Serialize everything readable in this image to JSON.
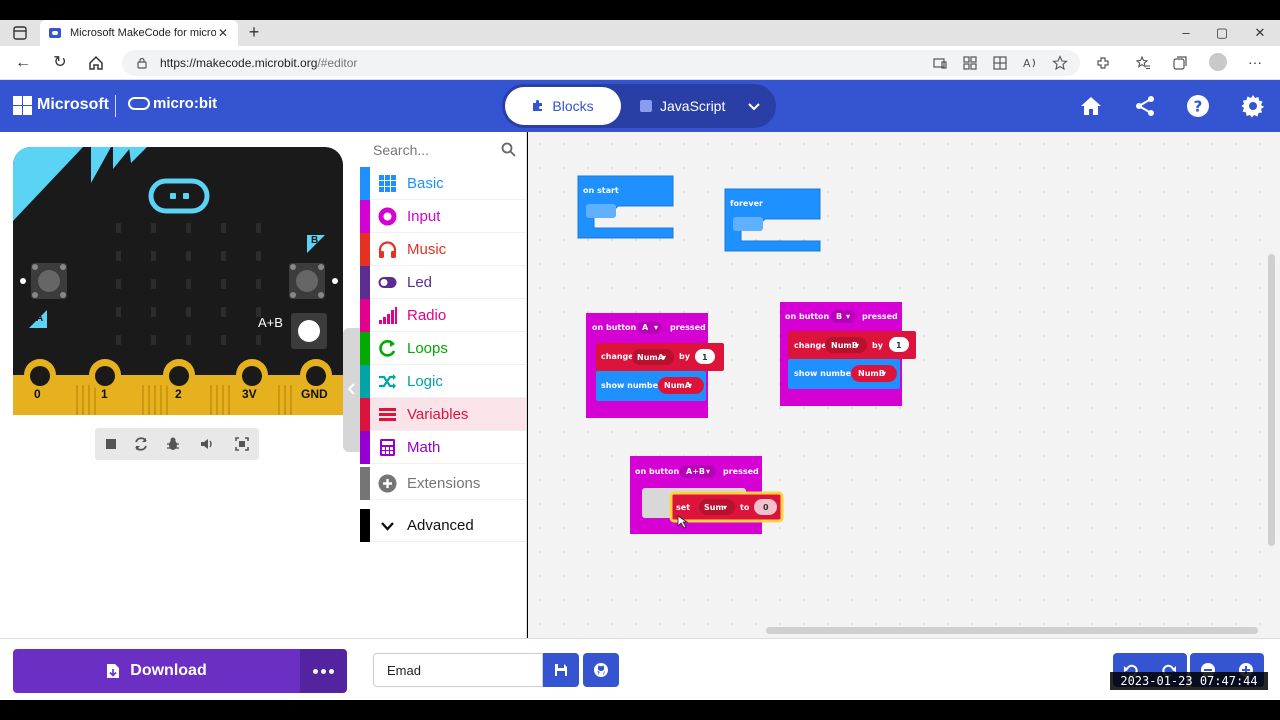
{
  "browser": {
    "tab_title": "Microsoft MakeCode for micro:bit",
    "tab_close": "✕",
    "new_tab": "+",
    "url_host": "https://makecode.microbit.org",
    "url_path": "/#editor",
    "window_controls": [
      "–",
      "▢",
      "✕"
    ]
  },
  "header": {
    "brand": "Microsoft",
    "product": "micro:bit",
    "blocks_label": "Blocks",
    "javascript_label": "JavaScript",
    "icons": [
      "home-icon",
      "share-icon",
      "help-icon",
      "settings-icon"
    ]
  },
  "simulator": {
    "pin_labels": [
      "0",
      "1",
      "2",
      "3V",
      "GND"
    ],
    "button_a_label": "A",
    "button_b_label": "B",
    "button_ab_label": "A+B",
    "controls": [
      "stop-icon",
      "restart-icon",
      "debug-icon",
      "sound-icon",
      "fullscreen-icon"
    ]
  },
  "toolbox": {
    "search_placeholder": "Search...",
    "categories": [
      {
        "label": "Basic",
        "color": "#1e90ff"
      },
      {
        "label": "Input",
        "color": "#d400d4"
      },
      {
        "label": "Music",
        "color": "#e63022"
      },
      {
        "label": "Led",
        "color": "#5c2d91"
      },
      {
        "label": "Radio",
        "color": "#e3008c"
      },
      {
        "label": "Loops",
        "color": "#00aa00"
      },
      {
        "label": "Logic",
        "color": "#00a4a6"
      },
      {
        "label": "Variables",
        "color": "#dc143c"
      },
      {
        "label": "Math",
        "color": "#9400d3"
      },
      {
        "label": "Extensions",
        "color": "#757575"
      },
      {
        "label": "Advanced",
        "color": "#000000"
      }
    ],
    "selected": "Variables"
  },
  "workspace": {
    "blocks": {
      "on_start": "on start",
      "forever": "forever",
      "on_button_a": {
        "on_button": "on button",
        "button": "A",
        "pressed": "pressed",
        "change": "change",
        "var": "NumA",
        "by": "by",
        "value": "1",
        "show_number": "show number"
      },
      "on_button_b": {
        "on_button": "on button",
        "button": "B",
        "pressed": "pressed",
        "change": "change",
        "var": "NumB",
        "by": "by",
        "value": "1",
        "show_number": "show number"
      },
      "on_button_ab": {
        "on_button": "on button",
        "button": "A+B",
        "pressed": "pressed",
        "set": "set",
        "var": "Sum",
        "to": "to",
        "value": "0"
      }
    },
    "colors": {
      "event_blue": "#1e90ff",
      "input_magenta": "#d400d4",
      "variables_red": "#dc143c"
    }
  },
  "footer": {
    "download_label": "Download",
    "project_name": "Emad"
  },
  "overlay": {
    "timestamp": "2023-01-23  07:47:44"
  }
}
